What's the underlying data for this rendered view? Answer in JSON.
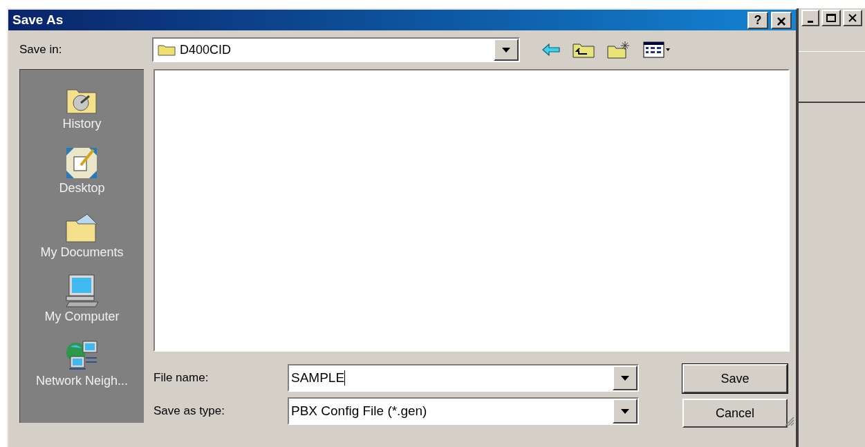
{
  "dialog": {
    "title": "Save As",
    "title_buttons": [
      {
        "kind": "help",
        "label": "?"
      },
      {
        "kind": "close",
        "label": "×"
      }
    ]
  },
  "save_in": {
    "label": "Save in:",
    "value": "D400CID"
  },
  "toolbar": [
    {
      "kind": "back"
    },
    {
      "kind": "up"
    },
    {
      "kind": "new-folder"
    },
    {
      "kind": "view"
    }
  ],
  "places": [
    {
      "kind": "history",
      "label": "History"
    },
    {
      "kind": "desktop",
      "label": "Desktop"
    },
    {
      "kind": "documents",
      "label": "My Documents"
    },
    {
      "kind": "computer",
      "label": "My Computer"
    },
    {
      "kind": "network",
      "label": "Network Neigh..."
    }
  ],
  "file_name": {
    "label": "File name:",
    "value": "SAMPLE"
  },
  "save_as_type": {
    "label": "Save as type:",
    "value": "PBX Config File (*.gen)"
  },
  "buttons": [
    {
      "label": "Save",
      "default": true
    },
    {
      "label": "Cancel",
      "default": false
    }
  ]
}
